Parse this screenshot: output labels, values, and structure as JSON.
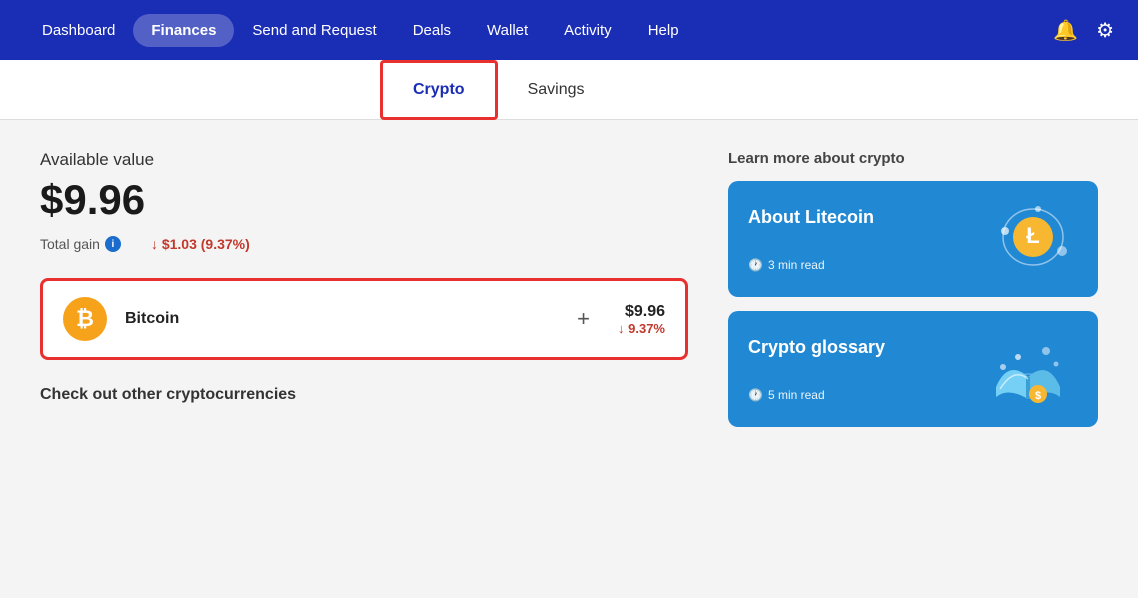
{
  "nav": {
    "items": [
      {
        "label": "Dashboard",
        "active": false
      },
      {
        "label": "Finances",
        "active": true
      },
      {
        "label": "Send and Request",
        "active": false
      },
      {
        "label": "Deals",
        "active": false
      },
      {
        "label": "Wallet",
        "active": false
      },
      {
        "label": "Activity",
        "active": false
      },
      {
        "label": "Help",
        "active": false
      }
    ]
  },
  "tabs": [
    {
      "label": "Crypto",
      "active": true
    },
    {
      "label": "Savings",
      "active": false
    }
  ],
  "main": {
    "available_label": "Available value",
    "available_value": "$9.96",
    "total_gain_label": "Total gain",
    "total_gain_value": "↓ $1.03 (9.37%)",
    "crypto_name": "Bitcoin",
    "crypto_usd": "$9.96",
    "crypto_pct": "↓ 9.37%",
    "check_other": "Check out other cryptocurrencies"
  },
  "right": {
    "learn_title": "Learn more about crypto",
    "cards": [
      {
        "title": "About Litecoin",
        "time": "3 min read"
      },
      {
        "title": "Crypto glossary",
        "time": "5 min read"
      }
    ]
  },
  "icons": {
    "bell": "🔔",
    "gear": "⚙",
    "info": "i",
    "clock": "🕐",
    "plus": "+",
    "arrow_down": "↓"
  }
}
